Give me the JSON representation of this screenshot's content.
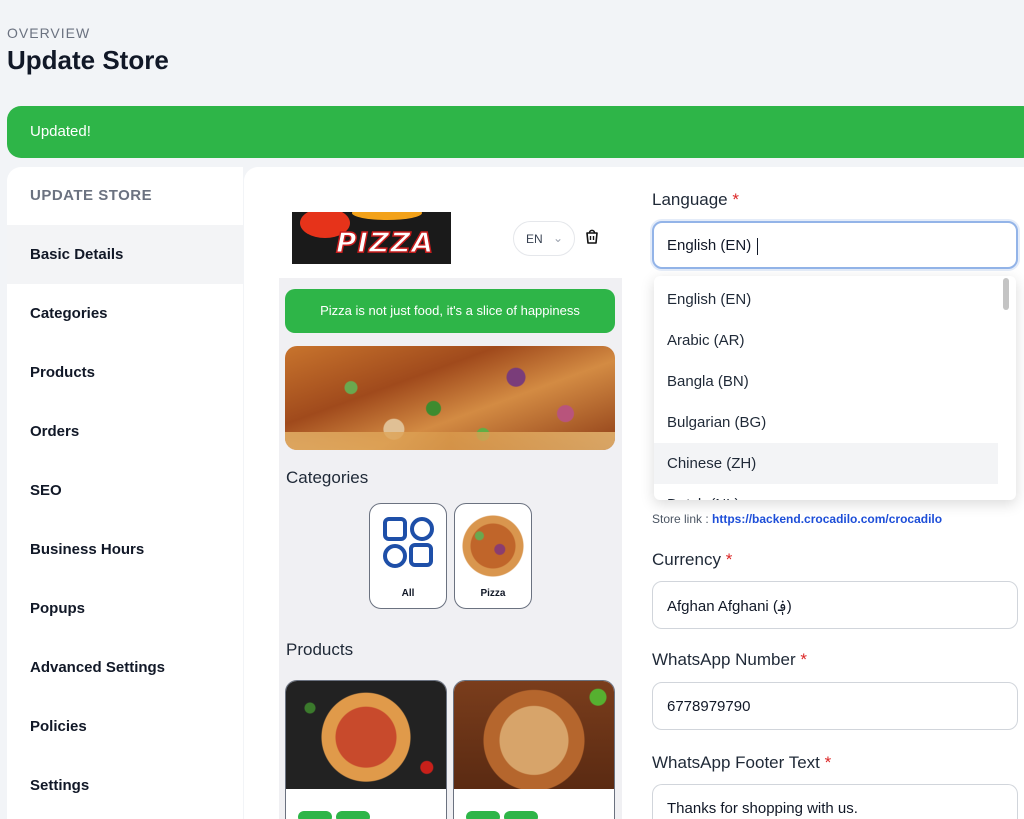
{
  "header": {
    "overview": "OVERVIEW",
    "title": "Update Store"
  },
  "alert": {
    "text": "Updated!"
  },
  "sidebar": {
    "header": "UPDATE STORE",
    "items": [
      {
        "label": "Basic Details"
      },
      {
        "label": "Categories"
      },
      {
        "label": "Products"
      },
      {
        "label": "Orders"
      },
      {
        "label": "SEO"
      },
      {
        "label": "Business Hours"
      },
      {
        "label": "Popups"
      },
      {
        "label": "Advanced Settings"
      },
      {
        "label": "Policies"
      },
      {
        "label": "Settings"
      }
    ]
  },
  "preview": {
    "logo_text": "PIZZA",
    "lang": "EN",
    "slogan": "Pizza is not just food, it's a slice of happiness",
    "categories_title": "Categories",
    "categories": [
      {
        "label": "All"
      },
      {
        "label": "Pizza"
      }
    ],
    "products_title": "Products"
  },
  "form": {
    "language": {
      "label": "Language",
      "value": "English (EN)"
    },
    "language_options": [
      "English (EN)",
      "Arabic (AR)",
      "Bangla (BN)",
      "Bulgarian (BG)",
      "Chinese (ZH)",
      "Dutch (NL)"
    ],
    "store_link": {
      "prefix": "Store link : ",
      "url": "https://backend.crocadilo.com/crocadilo"
    },
    "currency": {
      "label": "Currency",
      "value": "Afghan Afghani (؋)"
    },
    "whatsapp_number": {
      "label": "WhatsApp Number",
      "value": "6778979790"
    },
    "whatsapp_footer": {
      "label": "WhatsApp Footer Text",
      "value": "Thanks for shopping with us."
    },
    "required_mark": "*"
  },
  "colors": {
    "accent": "#2eb548",
    "link": "#1d4ed8",
    "required": "#dc2626"
  }
}
